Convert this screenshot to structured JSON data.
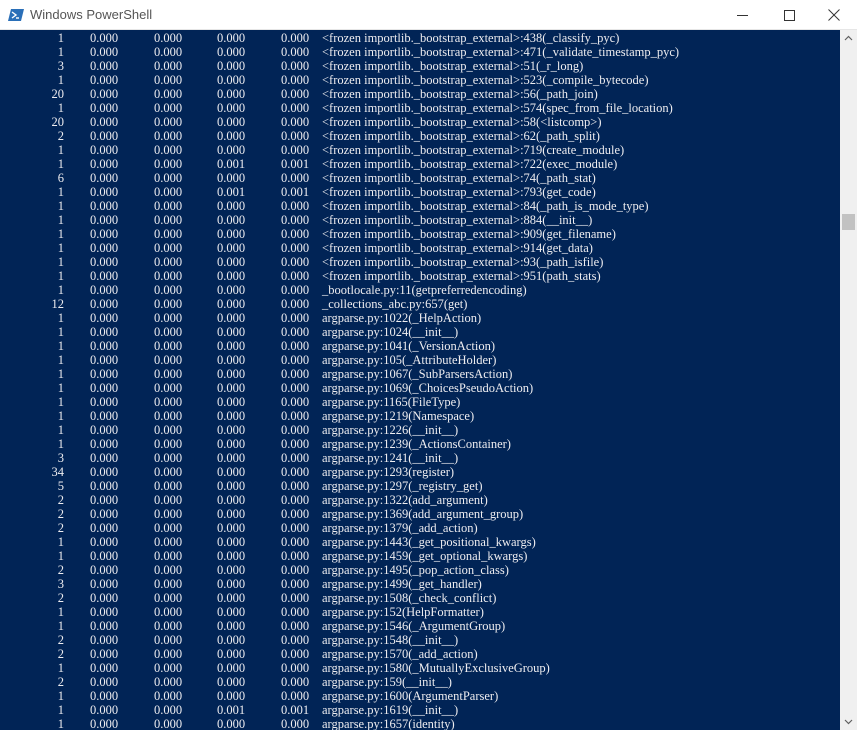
{
  "window": {
    "title": "Windows PowerShell",
    "icon": "powershell-icon",
    "controls": [
      "minimize-icon",
      "maximize-icon",
      "close-icon"
    ]
  },
  "colors": {
    "console_background": "#012456",
    "console_text": "#eeedf0",
    "titlebar_background": "#ffffff"
  },
  "console": {
    "rows": [
      {
        "ncalls": "1",
        "tottime": "0.000",
        "percall1": "0.000",
        "cumtime": "0.000",
        "percall2": "0.000",
        "func": "<frozen importlib._bootstrap_external>:438(_classify_pyc)"
      },
      {
        "ncalls": "1",
        "tottime": "0.000",
        "percall1": "0.000",
        "cumtime": "0.000",
        "percall2": "0.000",
        "func": "<frozen importlib._bootstrap_external>:471(_validate_timestamp_pyc)"
      },
      {
        "ncalls": "3",
        "tottime": "0.000",
        "percall1": "0.000",
        "cumtime": "0.000",
        "percall2": "0.000",
        "func": "<frozen importlib._bootstrap_external>:51(_r_long)"
      },
      {
        "ncalls": "1",
        "tottime": "0.000",
        "percall1": "0.000",
        "cumtime": "0.000",
        "percall2": "0.000",
        "func": "<frozen importlib._bootstrap_external>:523(_compile_bytecode)"
      },
      {
        "ncalls": "20",
        "tottime": "0.000",
        "percall1": "0.000",
        "cumtime": "0.000",
        "percall2": "0.000",
        "func": "<frozen importlib._bootstrap_external>:56(_path_join)"
      },
      {
        "ncalls": "1",
        "tottime": "0.000",
        "percall1": "0.000",
        "cumtime": "0.000",
        "percall2": "0.000",
        "func": "<frozen importlib._bootstrap_external>:574(spec_from_file_location)"
      },
      {
        "ncalls": "20",
        "tottime": "0.000",
        "percall1": "0.000",
        "cumtime": "0.000",
        "percall2": "0.000",
        "func": "<frozen importlib._bootstrap_external>:58(<listcomp>)"
      },
      {
        "ncalls": "2",
        "tottime": "0.000",
        "percall1": "0.000",
        "cumtime": "0.000",
        "percall2": "0.000",
        "func": "<frozen importlib._bootstrap_external>:62(_path_split)"
      },
      {
        "ncalls": "1",
        "tottime": "0.000",
        "percall1": "0.000",
        "cumtime": "0.000",
        "percall2": "0.000",
        "func": "<frozen importlib._bootstrap_external>:719(create_module)"
      },
      {
        "ncalls": "1",
        "tottime": "0.000",
        "percall1": "0.000",
        "cumtime": "0.001",
        "percall2": "0.001",
        "func": "<frozen importlib._bootstrap_external>:722(exec_module)"
      },
      {
        "ncalls": "6",
        "tottime": "0.000",
        "percall1": "0.000",
        "cumtime": "0.000",
        "percall2": "0.000",
        "func": "<frozen importlib._bootstrap_external>:74(_path_stat)"
      },
      {
        "ncalls": "1",
        "tottime": "0.000",
        "percall1": "0.000",
        "cumtime": "0.001",
        "percall2": "0.001",
        "func": "<frozen importlib._bootstrap_external>:793(get_code)"
      },
      {
        "ncalls": "1",
        "tottime": "0.000",
        "percall1": "0.000",
        "cumtime": "0.000",
        "percall2": "0.000",
        "func": "<frozen importlib._bootstrap_external>:84(_path_is_mode_type)"
      },
      {
        "ncalls": "1",
        "tottime": "0.000",
        "percall1": "0.000",
        "cumtime": "0.000",
        "percall2": "0.000",
        "func": "<frozen importlib._bootstrap_external>:884(__init__)"
      },
      {
        "ncalls": "1",
        "tottime": "0.000",
        "percall1": "0.000",
        "cumtime": "0.000",
        "percall2": "0.000",
        "func": "<frozen importlib._bootstrap_external>:909(get_filename)"
      },
      {
        "ncalls": "1",
        "tottime": "0.000",
        "percall1": "0.000",
        "cumtime": "0.000",
        "percall2": "0.000",
        "func": "<frozen importlib._bootstrap_external>:914(get_data)"
      },
      {
        "ncalls": "1",
        "tottime": "0.000",
        "percall1": "0.000",
        "cumtime": "0.000",
        "percall2": "0.000",
        "func": "<frozen importlib._bootstrap_external>:93(_path_isfile)"
      },
      {
        "ncalls": "1",
        "tottime": "0.000",
        "percall1": "0.000",
        "cumtime": "0.000",
        "percall2": "0.000",
        "func": "<frozen importlib._bootstrap_external>:951(path_stats)"
      },
      {
        "ncalls": "1",
        "tottime": "0.000",
        "percall1": "0.000",
        "cumtime": "0.000",
        "percall2": "0.000",
        "func": "_bootlocale.py:11(getpreferredencoding)"
      },
      {
        "ncalls": "12",
        "tottime": "0.000",
        "percall1": "0.000",
        "cumtime": "0.000",
        "percall2": "0.000",
        "func": "_collections_abc.py:657(get)"
      },
      {
        "ncalls": "1",
        "tottime": "0.000",
        "percall1": "0.000",
        "cumtime": "0.000",
        "percall2": "0.000",
        "func": "argparse.py:1022(_HelpAction)"
      },
      {
        "ncalls": "1",
        "tottime": "0.000",
        "percall1": "0.000",
        "cumtime": "0.000",
        "percall2": "0.000",
        "func": "argparse.py:1024(__init__)"
      },
      {
        "ncalls": "1",
        "tottime": "0.000",
        "percall1": "0.000",
        "cumtime": "0.000",
        "percall2": "0.000",
        "func": "argparse.py:1041(_VersionAction)"
      },
      {
        "ncalls": "1",
        "tottime": "0.000",
        "percall1": "0.000",
        "cumtime": "0.000",
        "percall2": "0.000",
        "func": "argparse.py:105(_AttributeHolder)"
      },
      {
        "ncalls": "1",
        "tottime": "0.000",
        "percall1": "0.000",
        "cumtime": "0.000",
        "percall2": "0.000",
        "func": "argparse.py:1067(_SubParsersAction)"
      },
      {
        "ncalls": "1",
        "tottime": "0.000",
        "percall1": "0.000",
        "cumtime": "0.000",
        "percall2": "0.000",
        "func": "argparse.py:1069(_ChoicesPseudoAction)"
      },
      {
        "ncalls": "1",
        "tottime": "0.000",
        "percall1": "0.000",
        "cumtime": "0.000",
        "percall2": "0.000",
        "func": "argparse.py:1165(FileType)"
      },
      {
        "ncalls": "1",
        "tottime": "0.000",
        "percall1": "0.000",
        "cumtime": "0.000",
        "percall2": "0.000",
        "func": "argparse.py:1219(Namespace)"
      },
      {
        "ncalls": "1",
        "tottime": "0.000",
        "percall1": "0.000",
        "cumtime": "0.000",
        "percall2": "0.000",
        "func": "argparse.py:1226(__init__)"
      },
      {
        "ncalls": "1",
        "tottime": "0.000",
        "percall1": "0.000",
        "cumtime": "0.000",
        "percall2": "0.000",
        "func": "argparse.py:1239(_ActionsContainer)"
      },
      {
        "ncalls": "3",
        "tottime": "0.000",
        "percall1": "0.000",
        "cumtime": "0.000",
        "percall2": "0.000",
        "func": "argparse.py:1241(__init__)"
      },
      {
        "ncalls": "34",
        "tottime": "0.000",
        "percall1": "0.000",
        "cumtime": "0.000",
        "percall2": "0.000",
        "func": "argparse.py:1293(register)"
      },
      {
        "ncalls": "5",
        "tottime": "0.000",
        "percall1": "0.000",
        "cumtime": "0.000",
        "percall2": "0.000",
        "func": "argparse.py:1297(_registry_get)"
      },
      {
        "ncalls": "2",
        "tottime": "0.000",
        "percall1": "0.000",
        "cumtime": "0.000",
        "percall2": "0.000",
        "func": "argparse.py:1322(add_argument)"
      },
      {
        "ncalls": "2",
        "tottime": "0.000",
        "percall1": "0.000",
        "cumtime": "0.000",
        "percall2": "0.000",
        "func": "argparse.py:1369(add_argument_group)"
      },
      {
        "ncalls": "2",
        "tottime": "0.000",
        "percall1": "0.000",
        "cumtime": "0.000",
        "percall2": "0.000",
        "func": "argparse.py:1379(_add_action)"
      },
      {
        "ncalls": "1",
        "tottime": "0.000",
        "percall1": "0.000",
        "cumtime": "0.000",
        "percall2": "0.000",
        "func": "argparse.py:1443(_get_positional_kwargs)"
      },
      {
        "ncalls": "1",
        "tottime": "0.000",
        "percall1": "0.000",
        "cumtime": "0.000",
        "percall2": "0.000",
        "func": "argparse.py:1459(_get_optional_kwargs)"
      },
      {
        "ncalls": "2",
        "tottime": "0.000",
        "percall1": "0.000",
        "cumtime": "0.000",
        "percall2": "0.000",
        "func": "argparse.py:1495(_pop_action_class)"
      },
      {
        "ncalls": "3",
        "tottime": "0.000",
        "percall1": "0.000",
        "cumtime": "0.000",
        "percall2": "0.000",
        "func": "argparse.py:1499(_get_handler)"
      },
      {
        "ncalls": "2",
        "tottime": "0.000",
        "percall1": "0.000",
        "cumtime": "0.000",
        "percall2": "0.000",
        "func": "argparse.py:1508(_check_conflict)"
      },
      {
        "ncalls": "1",
        "tottime": "0.000",
        "percall1": "0.000",
        "cumtime": "0.000",
        "percall2": "0.000",
        "func": "argparse.py:152(HelpFormatter)"
      },
      {
        "ncalls": "1",
        "tottime": "0.000",
        "percall1": "0.000",
        "cumtime": "0.000",
        "percall2": "0.000",
        "func": "argparse.py:1546(_ArgumentGroup)"
      },
      {
        "ncalls": "2",
        "tottime": "0.000",
        "percall1": "0.000",
        "cumtime": "0.000",
        "percall2": "0.000",
        "func": "argparse.py:1548(__init__)"
      },
      {
        "ncalls": "2",
        "tottime": "0.000",
        "percall1": "0.000",
        "cumtime": "0.000",
        "percall2": "0.000",
        "func": "argparse.py:1570(_add_action)"
      },
      {
        "ncalls": "1",
        "tottime": "0.000",
        "percall1": "0.000",
        "cumtime": "0.000",
        "percall2": "0.000",
        "func": "argparse.py:1580(_MutuallyExclusiveGroup)"
      },
      {
        "ncalls": "2",
        "tottime": "0.000",
        "percall1": "0.000",
        "cumtime": "0.000",
        "percall2": "0.000",
        "func": "argparse.py:159(__init__)"
      },
      {
        "ncalls": "1",
        "tottime": "0.000",
        "percall1": "0.000",
        "cumtime": "0.000",
        "percall2": "0.000",
        "func": "argparse.py:1600(ArgumentParser)"
      },
      {
        "ncalls": "1",
        "tottime": "0.000",
        "percall1": "0.000",
        "cumtime": "0.001",
        "percall2": "0.001",
        "func": "argparse.py:1619(__init__)"
      },
      {
        "ncalls": "1",
        "tottime": "0.000",
        "percall1": "0.000",
        "cumtime": "0.000",
        "percall2": "0.000",
        "func": "argparse.py:1657(identity)"
      }
    ]
  },
  "scrollbar": {
    "icons": [
      "scroll-up-arrow-icon",
      "scroll-down-arrow-icon"
    ]
  }
}
